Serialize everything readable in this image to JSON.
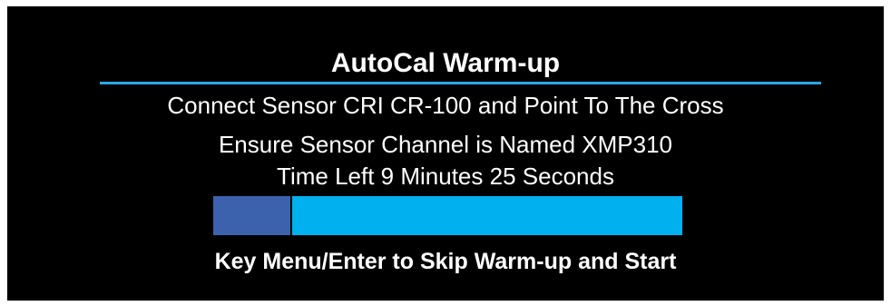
{
  "screen": {
    "title": "AutoCal Warm-up",
    "instruction_connect": "Connect Sensor CRI CR-100 and Point To The Cross",
    "instruction_channel": "Ensure Sensor Channel is Named XMP310",
    "time_left": "Time Left 9 Minutes 25 Seconds",
    "hint": "Key Menu/Enter to Skip Warm-up and Start"
  },
  "progress": {
    "elapsed_fraction": 0.165
  },
  "colors": {
    "background": "#000000",
    "text": "#ffffff",
    "title_rule": "#2aa6e6",
    "progress_elapsed": "#3d62ad",
    "progress_remaining": "#00b0ef"
  }
}
